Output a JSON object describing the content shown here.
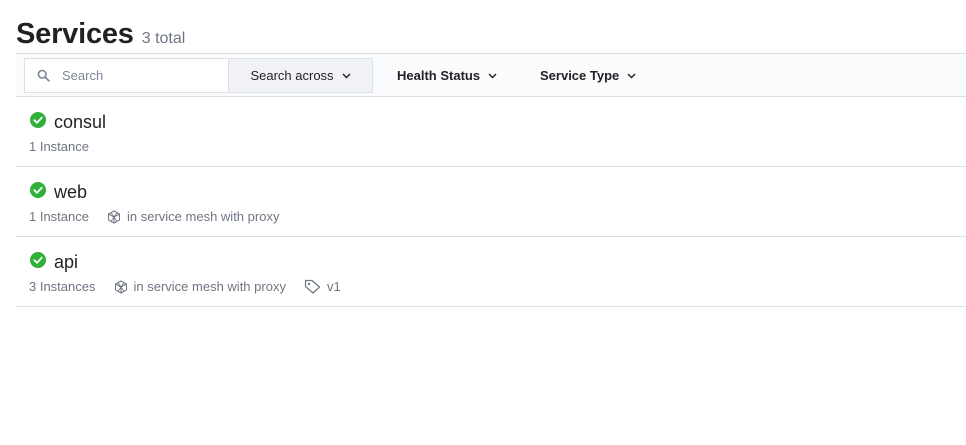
{
  "header": {
    "title": "Services",
    "count": "3 total"
  },
  "filters": {
    "search_placeholder": "Search",
    "search_across": "Search across",
    "health_status": "Health Status",
    "service_type": "Service Type"
  },
  "colors": {
    "healthy": "#2eb039",
    "text": "#1f2124",
    "muted": "#6f7682",
    "border": "#dce0e6"
  },
  "services": [
    {
      "name": "consul",
      "instances": "1 Instance",
      "status": "passing"
    },
    {
      "name": "web",
      "instances": "1 Instance",
      "mesh": "in service mesh with proxy",
      "status": "passing"
    },
    {
      "name": "api",
      "instances": "3 Instances",
      "mesh": "in service mesh with proxy",
      "tag": "v1",
      "status": "passing"
    }
  ]
}
